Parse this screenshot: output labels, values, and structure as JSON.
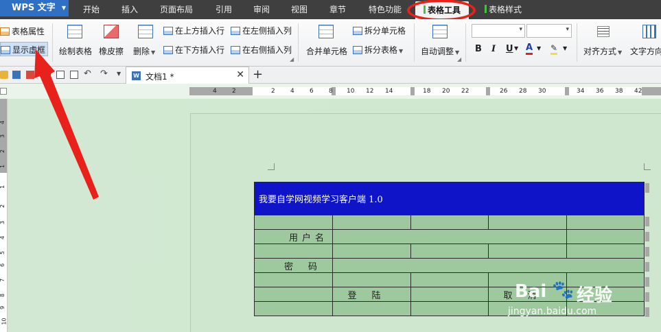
{
  "app": {
    "logo": "WPS 文字"
  },
  "menu_tabs": [
    "开始",
    "插入",
    "页面布局",
    "引用",
    "审阅",
    "视图",
    "章节",
    "特色功能",
    "表格工具",
    "表格样式"
  ],
  "ribbon": {
    "table_props": "表格属性",
    "show_gridlines": "显示虚框",
    "draw_table": "绘制表格",
    "eraser": "橡皮擦",
    "delete": "删除",
    "insert_above": "在上方插入行",
    "insert_below": "在下方插入行",
    "insert_left": "在左侧插入列",
    "insert_right": "在右侧插入列",
    "merge_cells": "合并单元格",
    "split_cells": "拆分单元格",
    "split_table": "拆分表格",
    "auto_fit": "自动调整",
    "bold": "B",
    "italic": "I",
    "underline": "U",
    "align": "对齐方式",
    "text_direction": "文字方向"
  },
  "doc_tab": {
    "title": "文档1 *"
  },
  "ruler": {
    "h_numbers": [
      "4",
      "2",
      "2",
      "4",
      "6",
      "8",
      "10",
      "12",
      "14",
      "18",
      "20",
      "22",
      "26",
      "28",
      "30",
      "34",
      "36",
      "38",
      "42"
    ],
    "v_numbers": [
      "4",
      "3",
      "2",
      "1",
      "1",
      "2",
      "3",
      "4",
      "5",
      "6",
      "7",
      "8",
      "9",
      "10"
    ]
  },
  "table": {
    "header": "我要自学网视频学习客户端 1.0",
    "username_label": "用户名",
    "password_label": "密码",
    "login_button": "登陆",
    "cancel_button": "取消"
  },
  "watermark": {
    "brand": "Bai",
    "suffix": "经验",
    "url": "jingyan.baidu.com"
  },
  "colors": {
    "accent_red": "#e8221b",
    "table_header": "#0f14c8",
    "cell_green": "#9ec99e",
    "menu_bar": "#3f3f3f"
  }
}
